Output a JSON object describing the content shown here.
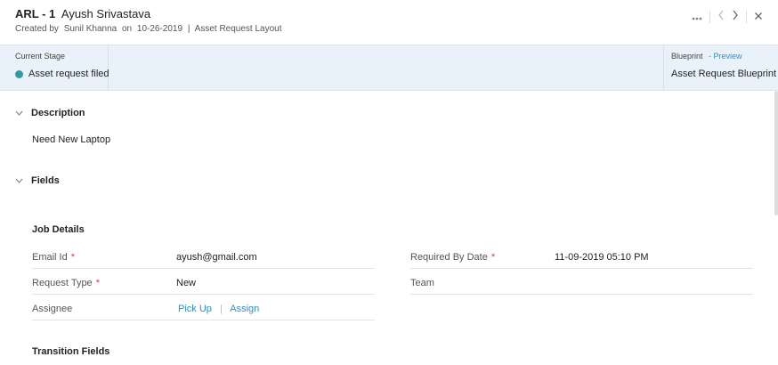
{
  "header": {
    "record_id": "ARL - 1",
    "record_name": "Ayush Srivastava",
    "created_by_label": "Created by",
    "creator": "Sunil Khanna",
    "on_label": "on",
    "created_date": "10-26-2019",
    "separator": "|",
    "layout_name": "Asset Request Layout",
    "icons": [
      "more-icon",
      "prev-icon",
      "next-icon",
      "close-icon"
    ]
  },
  "stage": {
    "caption": "Current Stage",
    "value": "Asset request filed",
    "dot_color": "#2e9aa8"
  },
  "blueprint": {
    "caption": "Blueprint",
    "preview_label": "- Preview",
    "value": "Asset Request Blueprint"
  },
  "description": {
    "heading": "Description",
    "text": "Need New Laptop"
  },
  "fields": {
    "heading": "Fields",
    "job_details": {
      "heading": "Job Details",
      "email": {
        "label": "Email Id",
        "value": "ayush@gmail.com"
      },
      "required_by": {
        "label": "Required By Date",
        "value": "11-09-2019 05:10 PM"
      },
      "request_type": {
        "label": "Request Type",
        "value": "New"
      },
      "team": {
        "label": "Team",
        "value": ""
      },
      "assignee": {
        "label": "Assignee",
        "pickup": "Pick Up",
        "pipe": "|",
        "assign": "Assign"
      }
    },
    "transition_heading": "Transition Fields"
  },
  "required_marker": "*"
}
